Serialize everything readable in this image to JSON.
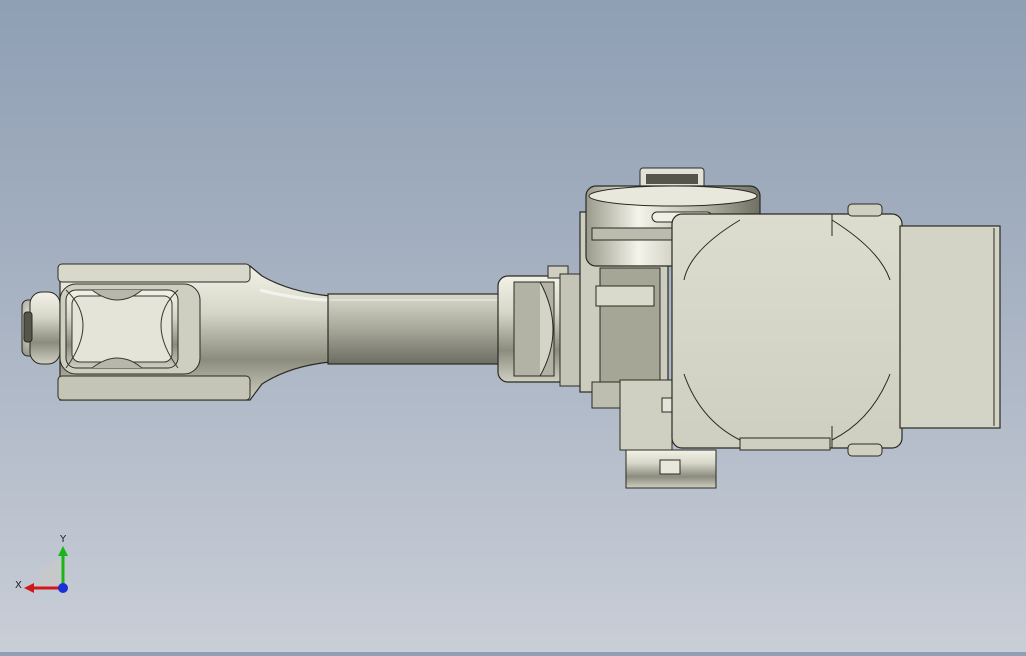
{
  "viewport": {
    "background_top": "#8f9fb4",
    "background_bottom": "#c9ced7",
    "model": "robot-arm",
    "part_color": "#d8d8c8",
    "edge_color": "#2a2a22"
  },
  "triad": {
    "x_label": "X",
    "y_label": "Y",
    "x_color": "#d01818",
    "y_color": "#19b519",
    "z_color": "#1a2fd6"
  }
}
